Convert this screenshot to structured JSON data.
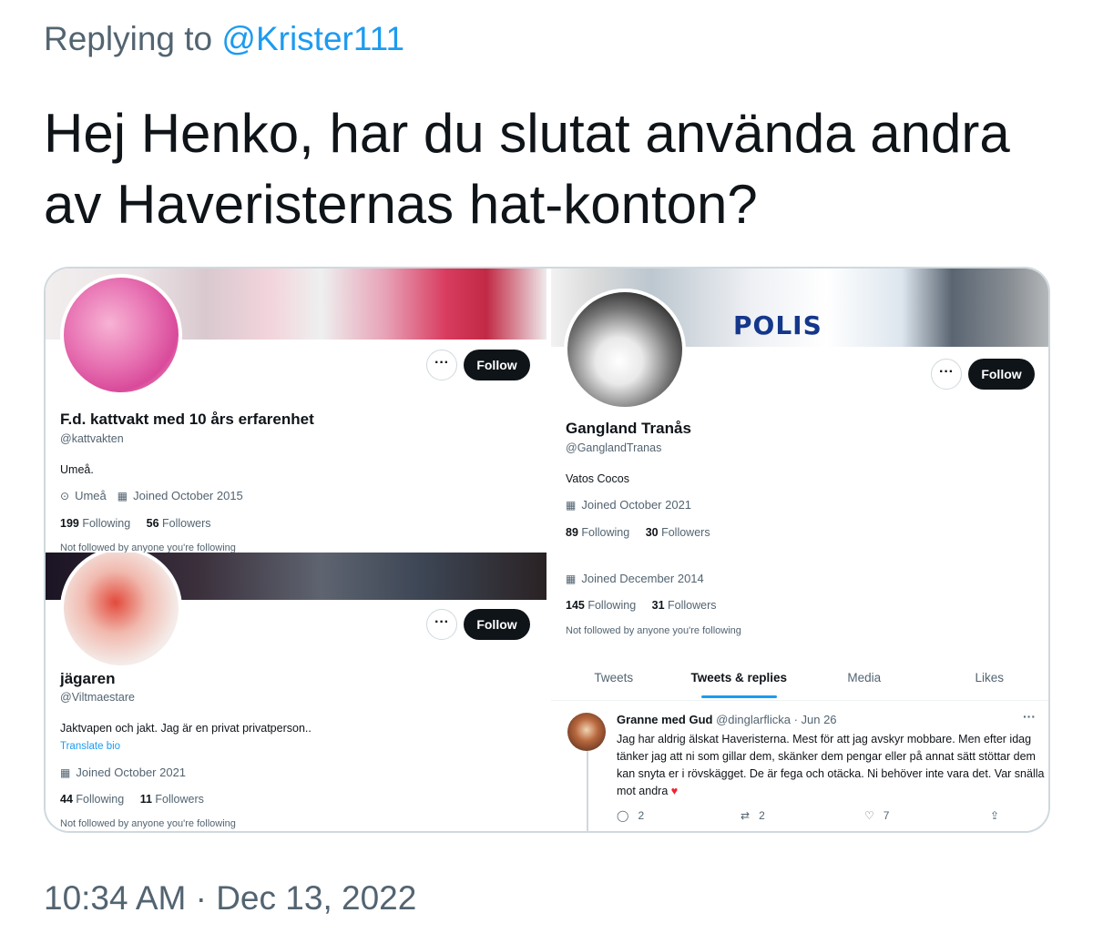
{
  "reply": {
    "prefix": "Replying to ",
    "handle": "@Krister111"
  },
  "tweet": {
    "text": "Hej Henko, har du slutat använda andra av Haveristernas hat-konton?"
  },
  "timestamp": "10:34 AM · Dec 13, 2022",
  "profiles": [
    {
      "name": "F.d. kattvakt med 10 års erfarenhet",
      "handle": "@kattvakten",
      "bio": "Umeå.",
      "location": "Umeå",
      "joined": "Joined October 2015",
      "following_count": "199",
      "following_label": "Following",
      "followers_count": "56",
      "followers_label": "Followers",
      "not_followed": "Not followed by anyone you're following",
      "more_label": "···",
      "follow_label": "Follow"
    },
    {
      "name": "Gangland Tranås",
      "handle": "@GanglandTranas",
      "bio": "Vatos Cocos",
      "joined": "Joined October 2021",
      "following_count": "89",
      "following_label": "Following",
      "followers_count": "30",
      "followers_label": "Followers",
      "more_label": "···",
      "follow_label": "Follow",
      "banner_text": "POLIS"
    },
    {
      "name": "jägaren",
      "handle": "@Viltmaestare",
      "bio": "Jaktvapen och jakt. Jag är en privat privatperson..",
      "translate": "Translate bio",
      "joined": "Joined October 2021",
      "following_count": "44",
      "following_label": "Following",
      "followers_count": "11",
      "followers_label": "Followers",
      "not_followed": "Not followed by anyone you're following",
      "more_label": "···",
      "follow_label": "Follow"
    }
  ],
  "overlap_profile": {
    "joined": "Joined December 2014",
    "following_count": "145",
    "following_label": "Following",
    "followers_count": "31",
    "followers_label": "Followers",
    "not_followed": "Not followed by anyone you're following"
  },
  "tabs": [
    "Tweets",
    "Tweets & replies",
    "Media",
    "Likes"
  ],
  "reply_tweet": {
    "author": "Granne med Gud",
    "handle": "@dinglarflicka",
    "date": "· Jun 26",
    "text": "Jag har aldrig älskat Haveristerna. Mest för att jag avskyr mobbare. Men efter idag tänker jag att ni som gillar dem, skänker dem pengar eller på annat sätt stöttar dem kan snyta er i rövskägget. De är fega och otäcka. Ni behöver inte vara det. Var snälla mot andra",
    "replies": "2",
    "retweets": "2",
    "likes": "7",
    "more_label": "···"
  }
}
